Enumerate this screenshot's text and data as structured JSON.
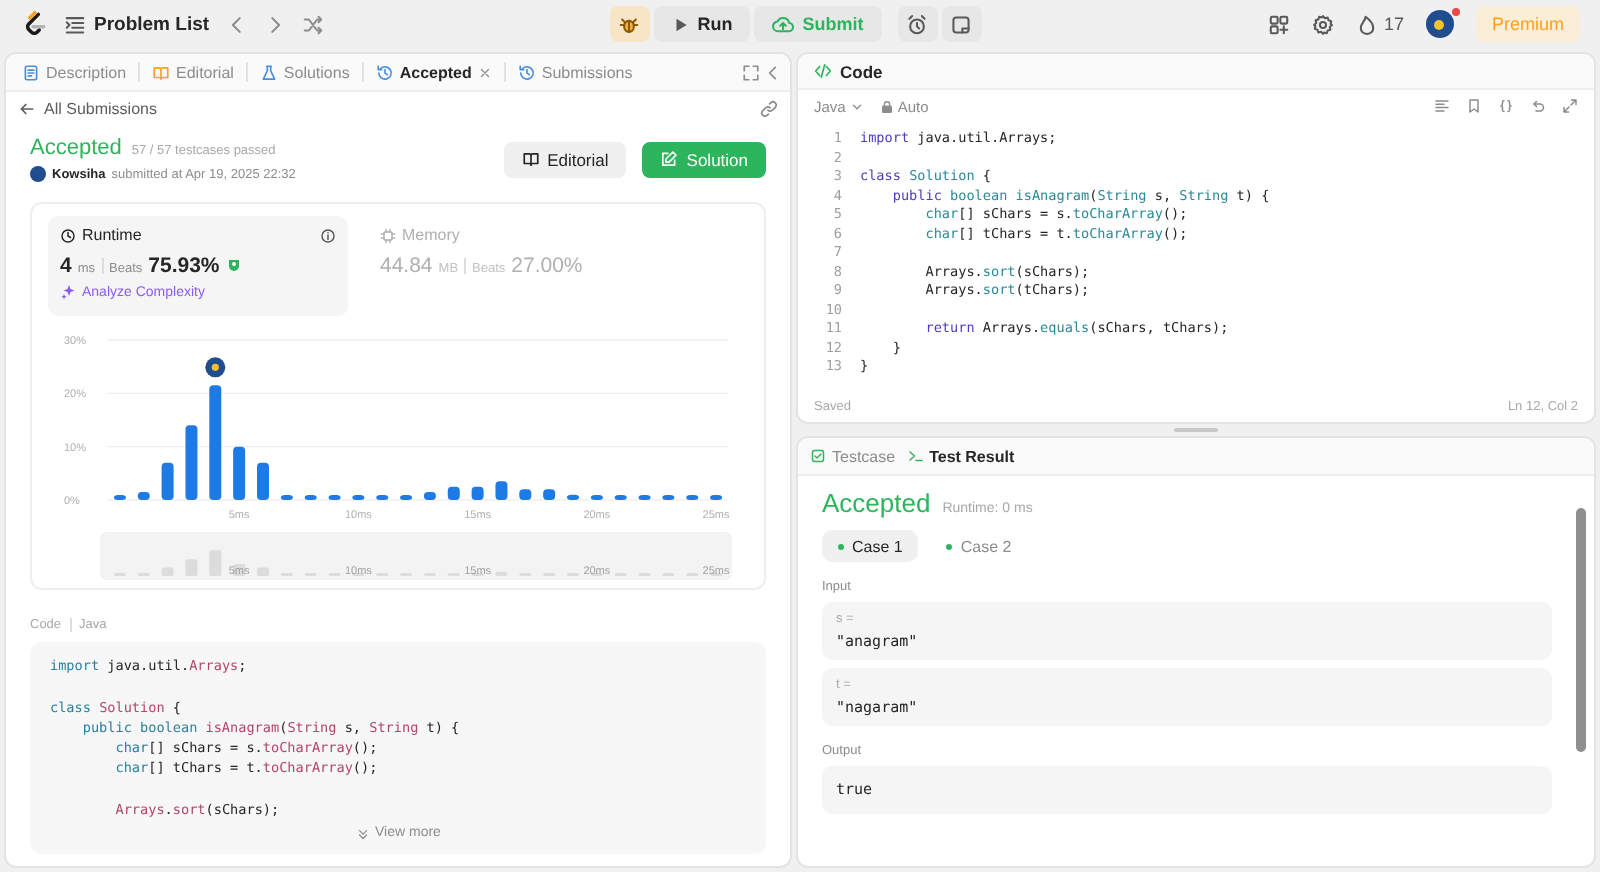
{
  "top_bar": {
    "problem_list": "Problem List",
    "run": "Run",
    "submit": "Submit",
    "streak": "17",
    "premium": "Premium"
  },
  "left_panel": {
    "tabs": [
      {
        "label": "Description",
        "kind": "description",
        "selected": false,
        "closable": false
      },
      {
        "label": "Editorial",
        "kind": "editorial",
        "selected": false,
        "closable": false
      },
      {
        "label": "Solutions",
        "kind": "solutions",
        "selected": false,
        "closable": false
      },
      {
        "label": "Accepted",
        "kind": "history",
        "selected": true,
        "closable": true
      },
      {
        "label": "Submissions",
        "kind": "history",
        "selected": false,
        "closable": false
      }
    ],
    "back_link": "All Submissions",
    "submission": {
      "status": "Accepted",
      "testcases": "57 / 57 testcases passed",
      "user": "Kowsiha",
      "submitted": "submitted at Apr 19, 2025 22:32"
    },
    "buttons": [
      {
        "label": "Editorial",
        "kind": "secondary"
      },
      {
        "label": "Solution",
        "kind": "primary"
      }
    ],
    "metrics": [
      {
        "title": "Runtime",
        "kind": "runtime",
        "selected": true,
        "value": "4",
        "unit": "ms",
        "beats_label": "Beats",
        "beats": "75.93%",
        "link": "Analyze Complexity"
      },
      {
        "title": "Memory",
        "kind": "memory",
        "selected": false,
        "value": "44.84",
        "unit": "MB",
        "beats_label": "Beats",
        "beats": "27.00%"
      }
    ],
    "chart_data": {
      "type": "bar",
      "x": [
        0,
        1,
        2,
        3,
        4,
        5,
        6,
        7,
        8,
        9,
        10,
        11,
        12,
        13,
        14,
        15,
        16,
        17,
        18,
        19,
        20,
        21,
        22,
        23,
        24,
        25
      ],
      "values": [
        0.5,
        1.5,
        7,
        14,
        21.5,
        10,
        7,
        0.5,
        0.5,
        0.5,
        0.5,
        0.5,
        0.5,
        1.5,
        2.5,
        2.5,
        3.5,
        2,
        2,
        1,
        0.5,
        0.5,
        0.5,
        0.5,
        0.5,
        0.5
      ],
      "xlim": [
        -0.5,
        25.5
      ],
      "ylim": [
        0,
        30
      ],
      "yticks": [
        {
          "value": 0,
          "label": "0%"
        },
        {
          "value": 10,
          "label": "10%"
        },
        {
          "value": 20,
          "label": "20%"
        },
        {
          "value": 30,
          "label": "30%"
        }
      ],
      "xticks": [
        {
          "value": 5,
          "label": "5ms"
        },
        {
          "value": 10,
          "label": "10ms"
        },
        {
          "value": 15,
          "label": "15ms"
        },
        {
          "value": 20,
          "label": "20ms"
        },
        {
          "value": 25,
          "label": "25ms"
        }
      ]
    },
    "overview_labels": [
      "5ms",
      "10ms",
      "15ms",
      "20ms",
      "25ms"
    ],
    "code_label": "Code",
    "language": "Java",
    "code_lines": [
      {
        "kind": "code",
        "tokens": [
          {
            "kind": "keyword",
            "text": "import"
          },
          {
            "kind": "plain",
            "text": " java.util."
          },
          {
            "kind": "type",
            "text": "Arrays"
          },
          {
            "kind": "plain",
            "text": ";"
          }
        ]
      },
      {
        "kind": "blank"
      },
      {
        "kind": "code",
        "tokens": [
          {
            "kind": "keyword",
            "text": "class "
          },
          {
            "kind": "type",
            "text": "Solution"
          },
          {
            "kind": "plain",
            "text": " {"
          }
        ]
      },
      {
        "kind": "code",
        "tokens": [
          {
            "kind": "keyword",
            "text": "    public boolean "
          },
          {
            "kind": "method",
            "text": "isAnagram"
          },
          {
            "kind": "plain",
            "text": "("
          },
          {
            "kind": "type",
            "text": "String"
          },
          {
            "kind": "plain",
            "text": " s, "
          },
          {
            "kind": "type",
            "text": "String"
          },
          {
            "kind": "plain",
            "text": " t) {"
          }
        ]
      },
      {
        "kind": "code",
        "tokens": [
          {
            "kind": "keyword",
            "text": "        char"
          },
          {
            "kind": "plain",
            "text": "[] sChars = s."
          },
          {
            "kind": "method",
            "text": "toCharArray"
          },
          {
            "kind": "plain",
            "text": "();"
          }
        ]
      },
      {
        "kind": "code",
        "tokens": [
          {
            "kind": "keyword",
            "text": "        char"
          },
          {
            "kind": "plain",
            "text": "[] tChars = t."
          },
          {
            "kind": "method",
            "text": "toCharArray"
          },
          {
            "kind": "plain",
            "text": "();"
          }
        ]
      },
      {
        "kind": "blank"
      },
      {
        "kind": "code",
        "tokens": [
          {
            "kind": "type",
            "text": "        Arrays"
          },
          {
            "kind": "plain",
            "text": "."
          },
          {
            "kind": "method",
            "text": "sort"
          },
          {
            "kind": "plain",
            "text": "(sChars);"
          }
        ]
      }
    ],
    "view_more": "View more"
  },
  "code_panel": {
    "title": "Code",
    "language": "Java",
    "mode": "Auto",
    "lines": [
      {
        "number": "1",
        "kind": "code",
        "tokens": [
          {
            "kind": "keyword",
            "text": "import"
          },
          {
            "kind": "plain",
            "text": " java.util.Arrays;"
          }
        ]
      },
      {
        "number": "2",
        "kind": "blank"
      },
      {
        "number": "3",
        "kind": "code",
        "tokens": [
          {
            "kind": "keyword",
            "text": "class "
          },
          {
            "kind": "type",
            "text": "Solution"
          },
          {
            "kind": "plain",
            "text": " {"
          }
        ]
      },
      {
        "number": "4",
        "kind": "code",
        "tokens": [
          {
            "kind": "keyword",
            "text": "    public "
          },
          {
            "kind": "type",
            "text": "boolean "
          },
          {
            "kind": "method",
            "text": "isAnagram"
          },
          {
            "kind": "plain",
            "text": "("
          },
          {
            "kind": "type",
            "text": "String"
          },
          {
            "kind": "plain",
            "text": " s, "
          },
          {
            "kind": "type",
            "text": "String"
          },
          {
            "kind": "plain",
            "text": " t) {"
          }
        ]
      },
      {
        "number": "5",
        "kind": "code",
        "tokens": [
          {
            "kind": "type",
            "text": "        char"
          },
          {
            "kind": "plain",
            "text": "[] sChars = s."
          },
          {
            "kind": "method",
            "text": "toCharArray"
          },
          {
            "kind": "plain",
            "text": "();"
          }
        ]
      },
      {
        "number": "6",
        "kind": "code",
        "tokens": [
          {
            "kind": "type",
            "text": "        char"
          },
          {
            "kind": "plain",
            "text": "[] tChars = t."
          },
          {
            "kind": "method",
            "text": "toCharArray"
          },
          {
            "kind": "plain",
            "text": "();"
          }
        ]
      },
      {
        "number": "7",
        "kind": "blank"
      },
      {
        "number": "8",
        "kind": "code",
        "tokens": [
          {
            "kind": "plain",
            "text": "        Arrays."
          },
          {
            "kind": "method",
            "text": "sort"
          },
          {
            "kind": "plain",
            "text": "(sChars);"
          }
        ]
      },
      {
        "number": "9",
        "kind": "code",
        "tokens": [
          {
            "kind": "plain",
            "text": "        Arrays."
          },
          {
            "kind": "method",
            "text": "sort"
          },
          {
            "kind": "plain",
            "text": "(tChars);"
          }
        ]
      },
      {
        "number": "10",
        "kind": "blank"
      },
      {
        "number": "11",
        "kind": "code",
        "tokens": [
          {
            "kind": "keyword",
            "text": "        return"
          },
          {
            "kind": "plain",
            "text": " Arrays."
          },
          {
            "kind": "method",
            "text": "equals"
          },
          {
            "kind": "plain",
            "text": "(sChars, tChars);"
          }
        ]
      },
      {
        "number": "12",
        "kind": "code",
        "tokens": [
          {
            "kind": "plain",
            "text": "    }"
          }
        ]
      },
      {
        "number": "13",
        "kind": "code",
        "tokens": [
          {
            "kind": "plain",
            "text": "}"
          }
        ]
      }
    ],
    "status": "Saved",
    "cursor": "Ln 12, Col 2"
  },
  "test_panel": {
    "tabs": [
      {
        "label": "Testcase",
        "kind": "testcase",
        "selected": false
      },
      {
        "label": "Test Result",
        "kind": "result",
        "selected": true
      }
    ],
    "status": "Accepted",
    "runtime": "Runtime: 0 ms",
    "cases": [
      {
        "label": "Case 1",
        "selected": true,
        "passed": true
      },
      {
        "label": "Case 2",
        "selected": false,
        "passed": true
      }
    ],
    "input_label": "Input",
    "inputs": [
      {
        "name": "s =",
        "value": "\"anagram\""
      },
      {
        "name": "t =",
        "value": "\"nagaram\""
      }
    ],
    "output_label": "Output",
    "output": "true"
  }
}
